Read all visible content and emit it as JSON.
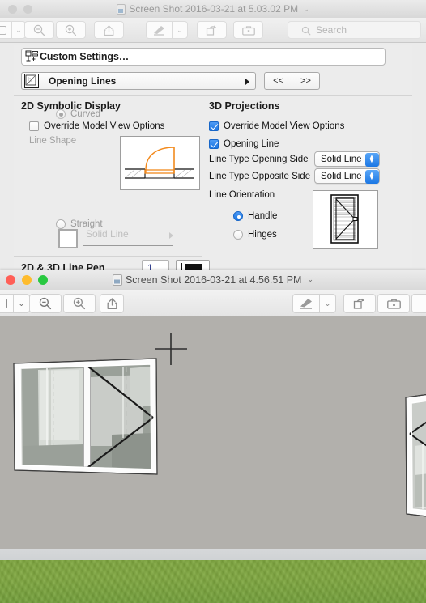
{
  "window1": {
    "title": "Screen Shot 2016-03-21 at 5.03.02 PM",
    "title_chevron": "⌄",
    "traffic_lights": [
      "close",
      "minimize",
      "zoom"
    ],
    "toolbar": {
      "sidebar_toggle": "sidebar-icon",
      "sidebar_chevron": "⌄",
      "zoom_out": "zoom-out-icon",
      "zoom_in": "zoom-in-icon",
      "share": "share-icon",
      "markup": "markup-pen-icon",
      "markup_chevron": "⌄",
      "rotate": "rotate-icon",
      "toolbox": "toolbox-icon",
      "search_placeholder": "Search"
    }
  },
  "dialog": {
    "custom_settings": {
      "label": "Custom Settings…",
      "icon": "custom-settings-icon"
    },
    "page_popup": {
      "label": "Opening Lines",
      "icon": "opening-lines-icon",
      "prev_label": "<<",
      "next_label": ">>"
    },
    "left_panel": {
      "title": "2D Symbolic Display",
      "override_checkbox": {
        "label": "Override Model View Options",
        "checked": false
      },
      "line_shape_label": "Line Shape",
      "radios": [
        {
          "label": "Curved",
          "selected": true,
          "enabled": false
        },
        {
          "label": "Straight",
          "selected": false,
          "enabled": false
        }
      ],
      "line_type": {
        "value": "Solid Line",
        "enabled": false
      },
      "line_pen": {
        "label": "2D & 3D Line Pen",
        "pen_number": "1",
        "pen_color": "#111111"
      },
      "preview_name": "door-swing-preview",
      "preview_accent": "#F28A1E"
    },
    "right_panel": {
      "title": "3D Projections",
      "override_checkbox": {
        "label": "Override Model View Options",
        "checked": true
      },
      "opening_line_checkbox": {
        "label": "Opening Line",
        "checked": true
      },
      "line_type_opening_side": {
        "label": "Line Type Opening Side",
        "value": "Solid Line"
      },
      "line_type_opposite_side": {
        "label": "Line Type Opposite Side",
        "value": "Solid Line"
      },
      "line_orientation": {
        "label": "Line Orientation",
        "radios": [
          {
            "label": "Handle",
            "selected": true
          },
          {
            "label": "Hinges",
            "selected": false
          }
        ],
        "preview_name": "line-orientation-preview"
      }
    },
    "accent_blue": "#1b77e4"
  },
  "window2": {
    "title": "Screen Shot 2016-03-21 at 4.56.51 PM",
    "title_chevron": "⌄",
    "toolbar": {
      "sidebar_toggle": "sidebar-icon",
      "sidebar_chevron": "⌄",
      "zoom_out": "zoom-out-icon",
      "zoom_in": "zoom-in-icon",
      "share": "share-icon",
      "markup": "markup-pen-icon",
      "markup_chevron": "⌄",
      "rotate": "rotate-icon",
      "toolbox": "toolbox-icon"
    },
    "viewport": {
      "name": "3d-model-viewport",
      "sky_color": "#b2b0ac",
      "ground_color": "#7fa83e",
      "horizon_color": "#d6d8da",
      "objects": [
        {
          "name": "door-assembly-main",
          "opening_line": "handle-side-triangle"
        },
        {
          "name": "door-assembly-right-partial",
          "opening_line": "handle-side-triangle"
        }
      ],
      "cursor": "crosshair-cursor"
    }
  }
}
